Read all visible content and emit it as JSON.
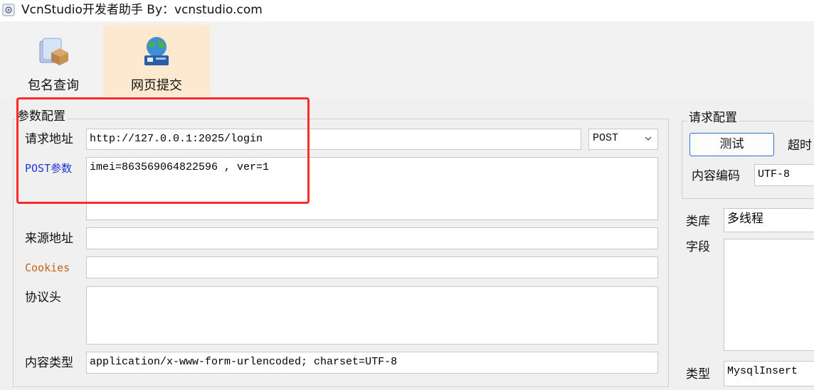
{
  "window": {
    "title": "VcnStudio开发者助手 By：vcnstudio.com",
    "icon": "gear-app-icon"
  },
  "toolbar": {
    "items": [
      {
        "label": "包名查询",
        "icon": "package-box-icon",
        "active": false
      },
      {
        "label": "网页提交",
        "icon": "globe-network-icon",
        "active": true
      }
    ]
  },
  "params": {
    "title": "参数配置",
    "url_label": "请求地址",
    "url_value": "http://127.0.0.1:2025/login",
    "method": "POST",
    "post_label": "POST参数",
    "post_value": "imei=863569064822596 , ver=1",
    "referer_label": "来源地址",
    "referer_value": "",
    "cookies_label": "Cookies",
    "cookies_value": "",
    "headers_label": "协议头",
    "headers_value": "",
    "content_type_label": "内容类型",
    "content_type_value": "application/x-www-form-urlencoded; charset=UTF-8"
  },
  "request": {
    "title": "请求配置",
    "test_button": "测试",
    "timeout_label": "超时",
    "encoding_label": "内容编码",
    "encoding_value": "UTF-8"
  },
  "db": {
    "library_label": "类库",
    "library_value": "多线程",
    "fields_label": "字段",
    "type_label": "类型",
    "type_value": "MysqlInsert"
  },
  "colors": {
    "highlight": "#ff2a2a",
    "active_tab": "#fde9cf",
    "post_label": "#1f35d6",
    "cookies_label": "#c5601b"
  }
}
